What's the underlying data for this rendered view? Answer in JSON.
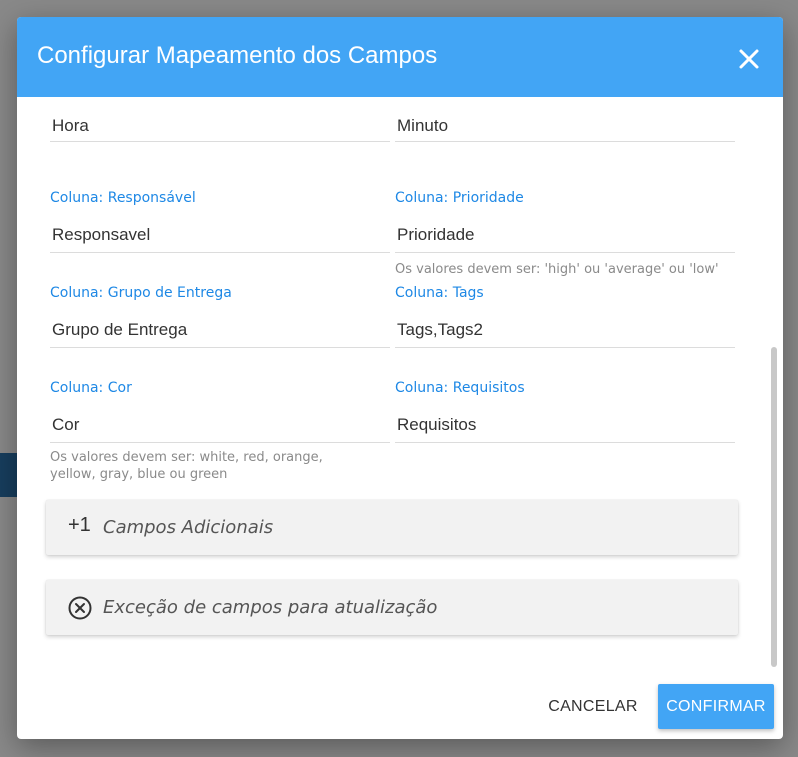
{
  "dialog": {
    "title": "Configurar Mapeamento dos Campos",
    "close_label": "×"
  },
  "fields": {
    "hora": {
      "value": "Hora"
    },
    "minuto": {
      "value": "Minuto"
    },
    "responsavel": {
      "label": "Coluna: Responsável",
      "value": "Responsavel"
    },
    "prioridade": {
      "label": "Coluna: Prioridade",
      "value": "Prioridade",
      "hint": "Os valores devem ser: 'high' ou 'average' ou 'low'"
    },
    "grupo": {
      "label": "Coluna: Grupo de Entrega",
      "value": "Grupo de Entrega"
    },
    "tags": {
      "label": "Coluna: Tags",
      "value": "Tags,Tags2"
    },
    "cor": {
      "label": "Coluna: Cor",
      "value": "Cor",
      "hint_line1": "Os valores devem ser: white, red, orange,",
      "hint_line2": "yellow, gray, blue ou green"
    },
    "requisitos": {
      "label": "Coluna: Requisitos",
      "value": "Requisitos"
    }
  },
  "panels": {
    "adicionais": {
      "icon": "+1",
      "label": "Campos Adicionais"
    },
    "excecao": {
      "icon": "circle-x-icon",
      "label": "Exceção de campos para atualização"
    }
  },
  "actions": {
    "cancel": "CANCELAR",
    "confirm": "CONFIRMAR"
  },
  "colors": {
    "accent": "#42a5f5",
    "label": "#1e88e5"
  }
}
